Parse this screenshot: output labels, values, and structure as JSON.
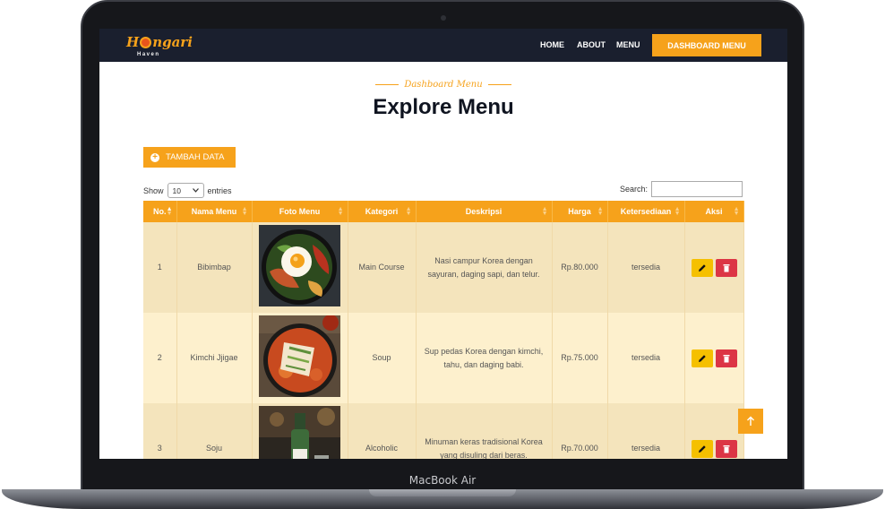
{
  "brand": {
    "name_start": "H",
    "name_rest": "ngari",
    "subtitle": "Haven"
  },
  "nav": {
    "items": [
      "HOME",
      "ABOUT",
      "MENU"
    ],
    "cta": "DASHBOARD MENU"
  },
  "heading": {
    "subtitle": "Dashboard Menu",
    "title": "Explore Menu"
  },
  "toolbar": {
    "add_label": "TAMBAH DATA"
  },
  "table_controls": {
    "show_label": "Show",
    "entries_value": "10",
    "entries_label": "entries",
    "search_label": "Search:"
  },
  "table": {
    "columns": [
      "No.",
      "Nama Menu",
      "Foto Menu",
      "Kategori",
      "Deskripsi",
      "Harga",
      "Ketersediaan",
      "Aksi"
    ],
    "rows": [
      {
        "no": "1",
        "name": "Bibimbap",
        "category": "Main Course",
        "description": "Nasi campur Korea dengan sayuran, daging sapi, dan telur.",
        "price": "Rp.80.000",
        "availability": "tersedia",
        "photo": "bibimbap"
      },
      {
        "no": "2",
        "name": "Kimchi Jjigae",
        "category": "Soup",
        "description": "Sup pedas Korea dengan kimchi, tahu, dan daging babi.",
        "price": "Rp.75.000",
        "availability": "tersedia",
        "photo": "kimchi-jjigae"
      },
      {
        "no": "3",
        "name": "Soju",
        "category": "Alcoholic",
        "description": "Minuman keras tradisional Korea yang disuling dari beras.",
        "price": "Rp.70.000",
        "availability": "tersedia",
        "photo": "soju"
      }
    ]
  },
  "device": {
    "label": "MacBook Air"
  },
  "colors": {
    "accent": "#f6a21b",
    "navbar": "#1a1f2e",
    "edit": "#f5c000",
    "delete": "#dc3545"
  }
}
